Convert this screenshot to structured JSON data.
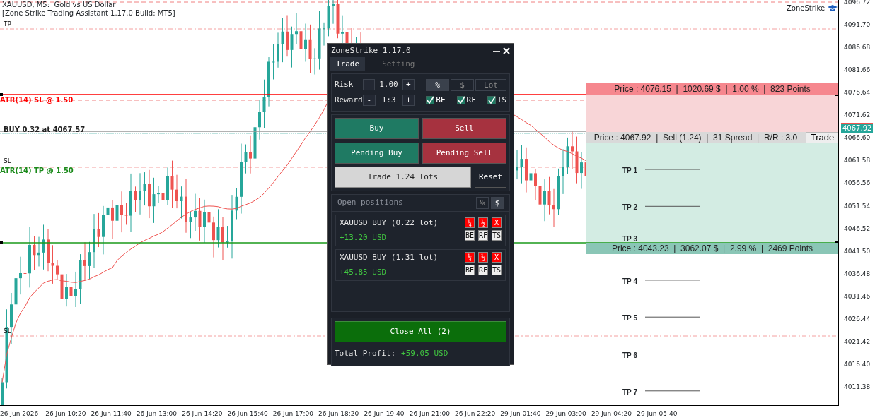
{
  "chart": {
    "title": "XAUUSD, M5:  Gold vs US Dollar",
    "subtitle": "[Zone Strike Trading Assistant 1.17.0 Build: MT5]",
    "brand": "ZoneStrike",
    "labels": [
      {
        "text": "TP",
        "kind": "plain"
      },
      {
        "text": "ATR(14) SL @ 1.50",
        "kind": "sl"
      },
      {
        "text": "BUY 0.32 at 4067.57",
        "kind": "entry"
      },
      {
        "text": "SL",
        "kind": "plain"
      },
      {
        "text": "ATR(14) TP @ 1.50",
        "kind": "tp"
      },
      {
        "text": "SL",
        "kind": "plain"
      }
    ]
  },
  "price_axis": {
    "ticks": [
      "4096.72",
      "4091.70",
      "4086.68",
      "4081.66",
      "4076.64",
      "4071.62",
      "4066.60",
      "4061.58",
      "4056.56",
      "4051.54",
      "4046.52",
      "4041.50",
      "4036.48",
      "4031.46",
      "4026.44",
      "4021.42",
      "4016.40",
      "4011.38"
    ],
    "current": "4067.92"
  },
  "time_axis": [
    "26 Jun 2026",
    "26 Jun 10:20",
    "26 Jun 11:40",
    "26 Jun 13:00",
    "26 Jun 14:20",
    "26 Jun 15:40",
    "26 Jun 17:00",
    "26 Jun 18:20",
    "26 Jun 19:40",
    "26 Jun 21:00",
    "26 Jun 22:20",
    "29 Jun 01:40",
    "29 Jun 03:00",
    "29 Jun 04:20",
    "29 Jun 05:40"
  ],
  "trade_zone": {
    "sl_info": "Price : 4076.15  |  1020.69 $  |  1.00 %  |  823 Points",
    "entry_info": "Price : 4067.92  |  Sell (1.24)  |  31 Spread  |  R/R : 3.0",
    "trade_button": "Trade",
    "tp_info": "Price : 4043.23  |  3062.07 $  |  2.99 %  |  2469 Points",
    "tp_levels": [
      "TP 1",
      "TP 2",
      "TP 3",
      "TP 4",
      "TP 5",
      "TP 6",
      "TP 7"
    ]
  },
  "panel": {
    "title": "ZoneStrike 1.17.0",
    "tabs": [
      {
        "label": "Trade",
        "selected": true
      },
      {
        "label": "Setting",
        "selected": false
      }
    ],
    "risk": {
      "label": "Risk",
      "minus": "-",
      "value": "1.00",
      "plus": "+"
    },
    "units": [
      {
        "label": "%",
        "selected": true
      },
      {
        "label": "$",
        "selected": false
      },
      {
        "label": "Lot",
        "selected": false
      }
    ],
    "reward": {
      "label": "Reward",
      "minus": "-",
      "value": "1:3",
      "plus": "+"
    },
    "options": [
      {
        "label": "BE",
        "checked": true
      },
      {
        "label": "RF",
        "checked": true
      },
      {
        "label": "TS",
        "checked": true
      }
    ],
    "order_buttons": [
      {
        "label": "Buy",
        "kind": "buy"
      },
      {
        "label": "Sell",
        "kind": "sell"
      },
      {
        "label": "Pending Buy",
        "kind": "buy"
      },
      {
        "label": "Pending Sell",
        "kind": "sell"
      }
    ],
    "trade_button": "Trade 1.24 lots",
    "reset_button": "Reset",
    "positions_header": "Open positions",
    "display": [
      {
        "label": "%",
        "selected": false
      },
      {
        "label": "$",
        "selected": true
      }
    ],
    "positions": [
      {
        "text": "XAUUSD BUY (0.22 lot)",
        "profit": "+13.20 USD",
        "actions": [
          "¼",
          "½",
          "X"
        ],
        "toggles": [
          "BE",
          "RF",
          "TS"
        ]
      },
      {
        "text": "XAUUSD BUY (1.31 lot)",
        "profit": "+45.85 USD",
        "actions": [
          "¼",
          "½",
          "X"
        ],
        "toggles": [
          "BE",
          "RF",
          "TS"
        ]
      }
    ],
    "close_all": "Close All (2)",
    "total_label": "Total Profit:",
    "total_value": "+59.05 USD"
  }
}
